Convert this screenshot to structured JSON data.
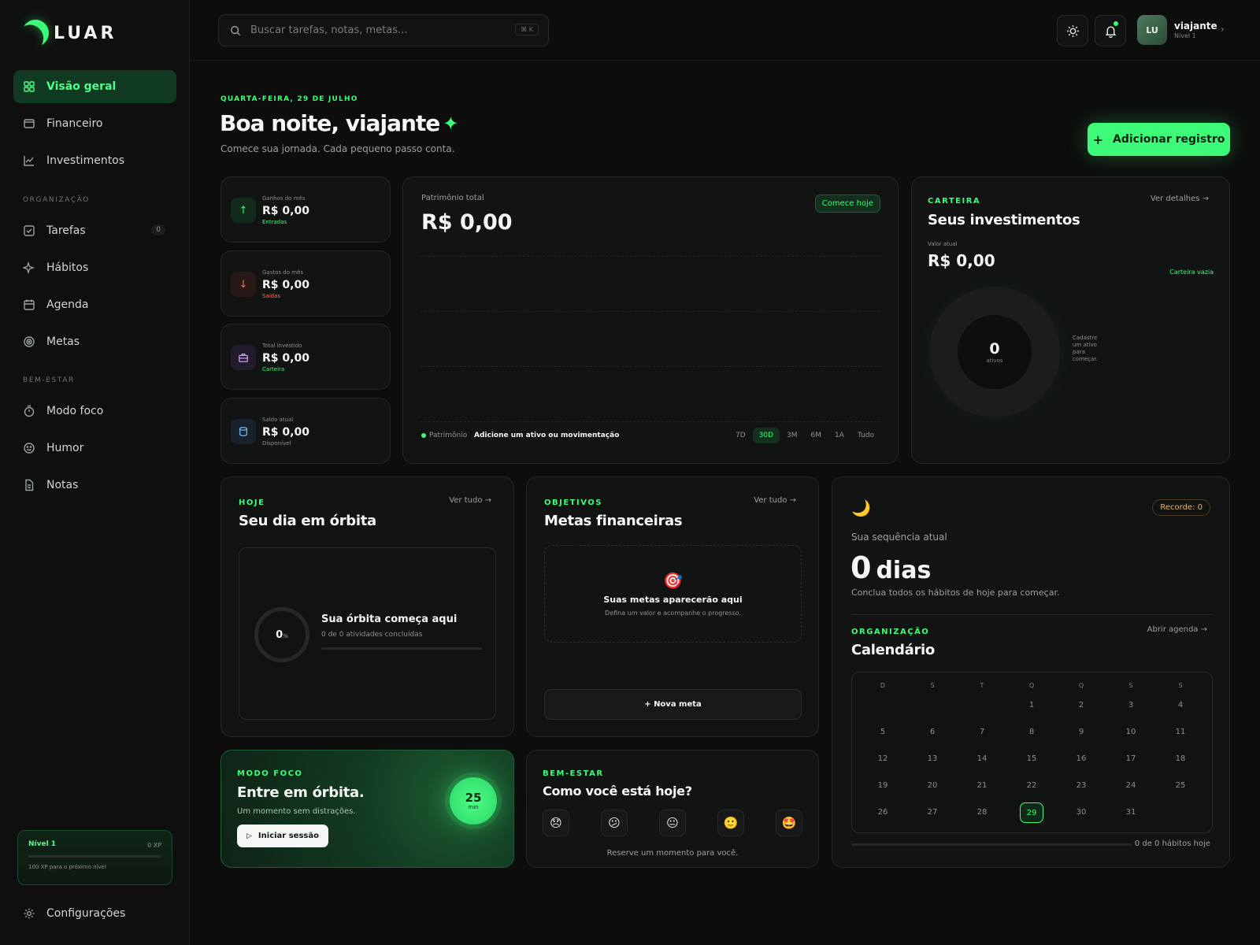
{
  "brand": {
    "name": "LUAR"
  },
  "sidebar": {
    "items": [
      {
        "label": "Visão geral",
        "icon": "grid-icon"
      },
      {
        "label": "Financeiro",
        "icon": "wallet-icon"
      },
      {
        "label": "Investimentos",
        "icon": "chart-line-icon"
      },
      {
        "label": "Tarefas",
        "icon": "checkbox-icon",
        "count": "0"
      },
      {
        "label": "Hábitos",
        "icon": "sparkles-icon"
      },
      {
        "label": "Agenda",
        "icon": "calendar-icon"
      },
      {
        "label": "Metas",
        "icon": "target-icon"
      },
      {
        "label": "Modo foco",
        "icon": "timer-icon"
      },
      {
        "label": "Humor",
        "icon": "smile-icon"
      },
      {
        "label": "Notas",
        "icon": "file-icon"
      }
    ],
    "sections": {
      "org": "ORGANIZAÇÃO",
      "wellbeing": "BEM-ESTAR"
    },
    "level": {
      "title": "Nível 1",
      "xp": "0 XP",
      "hint": "100 XP para o próximo nível",
      "progress": 0
    },
    "settings": "Configurações"
  },
  "topbar": {
    "search_placeholder": "Buscar tarefas, notas, metas...",
    "shortcut": "⌘ K",
    "user": {
      "initials": "LU",
      "name": "viajante",
      "level": "Nível 1"
    }
  },
  "header": {
    "date": "QUARTA-FEIRA, 29 DE JULHO",
    "greeting": "Boa noite, viajante",
    "subtitle": "Comece sua jornada. Cada pequeno passo conta.",
    "add_button": "Adicionar registro"
  },
  "stats": [
    {
      "label": "Ganhos do mês",
      "value": "R$ 0,00",
      "tag": "Entradas",
      "icon": "arrow-up-icon"
    },
    {
      "label": "Gastos do mês",
      "value": "R$ 0,00",
      "tag": "Saídas",
      "icon": "arrow-down-icon"
    },
    {
      "label": "Total investido",
      "value": "R$ 0,00",
      "tag": "Carteira",
      "icon": "briefcase-icon"
    },
    {
      "label": "Saldo atual",
      "value": "R$ 0,00",
      "tag": "Disponível",
      "icon": "database-icon"
    }
  ],
  "patrimonio": {
    "label": "Patrimônio total",
    "value": "R$ 0,00",
    "badge": "Comece hoje",
    "legend": "Patrimônio",
    "cta": "Adicione um ativo ou movimentação",
    "ranges": [
      "7D",
      "30D",
      "3M",
      "6M",
      "1A",
      "Tudo"
    ],
    "active_range": "30D"
  },
  "carteira": {
    "eyebrow": "CARTEIRA",
    "title": "Seus investimentos",
    "link": "Ver detalhes →",
    "value_label": "Valor atual",
    "value": "R$ 0,00",
    "status": "Carteira vazia",
    "count": "0",
    "count_label": "ativos",
    "hint": "Cadastre um ativo para começar."
  },
  "hoje": {
    "eyebrow": "HOJE",
    "title": "Seu dia em órbita",
    "link": "Ver tudo →",
    "percent": "0",
    "percent_unit": "%",
    "headline": "Sua órbita começa aqui",
    "detail": "0 de 0 atividades concluídas"
  },
  "metas": {
    "eyebrow": "OBJETIVOS",
    "title": "Metas financeiras",
    "link": "Ver tudo →",
    "empty_title": "Suas metas aparecerão aqui",
    "empty_sub": "Defina um valor e acompanhe o progresso.",
    "new_button": "+ Nova meta"
  },
  "streak": {
    "record": "Recorde: 0",
    "label": "Sua sequência atual",
    "days": "0",
    "days_unit": "dias",
    "hint": "Conclua todos os hábitos de hoje para começar."
  },
  "calendario": {
    "eyebrow": "ORGANIZAÇÃO",
    "title": "Calendário",
    "link": "Abrir agenda →",
    "weekdays": [
      "D",
      "S",
      "T",
      "Q",
      "Q",
      "S",
      "S"
    ],
    "days": [
      "1",
      "2",
      "3",
      "4",
      "5",
      "6",
      "7",
      "8",
      "9",
      "10",
      "11",
      "12",
      "13",
      "14",
      "15",
      "16",
      "17",
      "18",
      "19",
      "20",
      "21",
      "22",
      "23",
      "24",
      "25",
      "26",
      "27",
      "28",
      "29",
      "30",
      "31"
    ],
    "first_weekday": 3,
    "today": "29",
    "habits": "0 de 0 hábitos hoje"
  },
  "foco": {
    "eyebrow": "MODO FOCO",
    "title": "Entre em órbita.",
    "sub": "Um momento sem distrações.",
    "button": "Iniciar sessão",
    "minutes": "25",
    "unit": "min"
  },
  "humor": {
    "eyebrow": "BEM-ESTAR",
    "title": "Como você está hoje?",
    "hint": "Reserve um momento para você.",
    "moods": [
      "😞",
      "😕",
      "😐",
      "🙂",
      "🤩"
    ]
  },
  "colors": {
    "accent": "#3dfb78",
    "bg": "#0c0d0c",
    "card": "#121413"
  }
}
